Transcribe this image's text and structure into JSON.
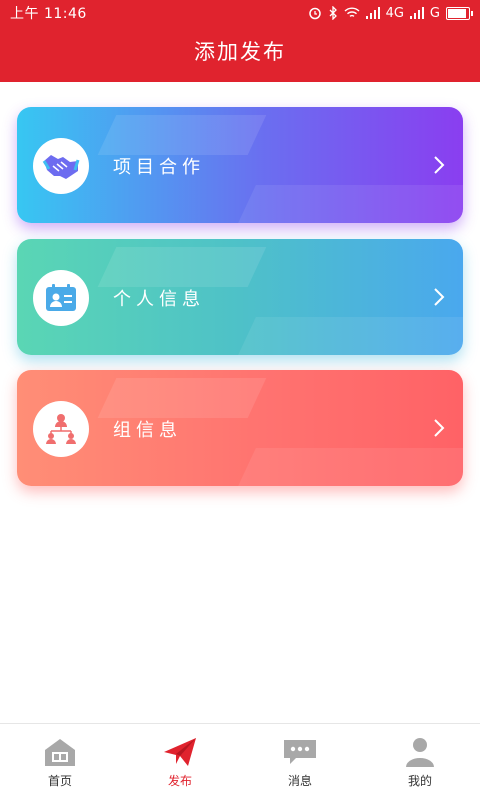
{
  "status_bar": {
    "time": "上午 11:46",
    "network": "4G",
    "network2": "G"
  },
  "header": {
    "title": "添加发布"
  },
  "cards": [
    {
      "label": "项目合作",
      "icon": "handshake-icon"
    },
    {
      "label": "个人信息",
      "icon": "id-card-icon"
    },
    {
      "label": "组信息",
      "icon": "group-icon"
    }
  ],
  "tabs": [
    {
      "label": "首页",
      "icon": "home-icon"
    },
    {
      "label": "发布",
      "icon": "paper-plane-icon",
      "active": true
    },
    {
      "label": "消息",
      "icon": "message-icon"
    },
    {
      "label": "我的",
      "icon": "user-icon"
    }
  ],
  "colors": {
    "brand": "#E0232E",
    "tab_inactive": "#999999"
  }
}
